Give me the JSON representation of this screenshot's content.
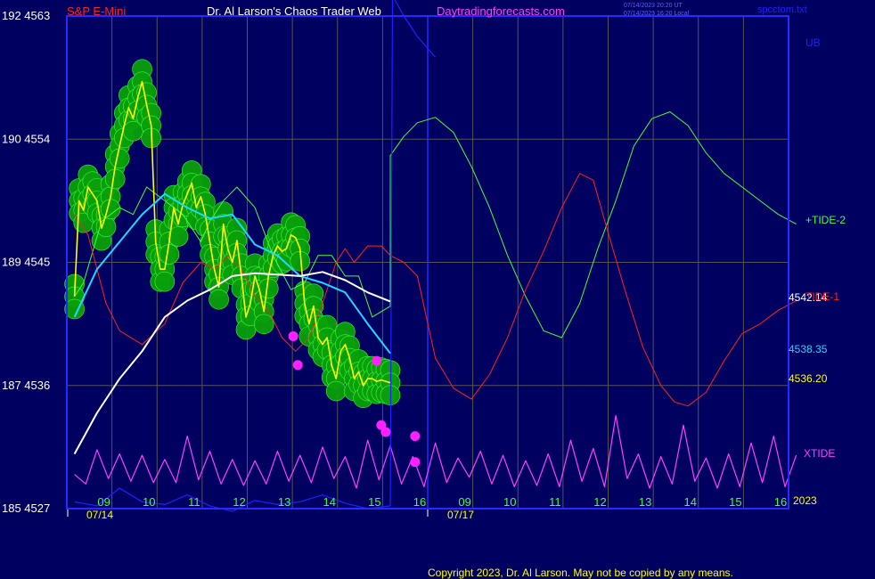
{
  "header": {
    "symbol": "S&P E-Mini",
    "title": "Dr. Al Larson's Chaos Trader Web",
    "site": "Daytradingforecasts.com",
    "stamp1": "07/14/2023 20:20 UT",
    "stamp2": "07/14/2023 16:20 Local",
    "file": "spcctom.txt"
  },
  "copyright": "Copyright 2023, Dr. Al Larson. May not be copied by any means.",
  "colors": {
    "background": "#000060",
    "frame": "#2828ff",
    "grid": "#555555",
    "price": "#ffff00",
    "avg_short": "#20d8ff",
    "avg_long": "#ffffff",
    "tide1": "#ff2020",
    "tide2": "#40ff40",
    "xtide": "#ff40ff",
    "ub": "#2020ff",
    "hour_labels": "#40ff40",
    "bubble": "#0aa00a",
    "bubble_edge": "#40ff40",
    "marker": "#ff20ff"
  },
  "chart_data": {
    "type": "line",
    "title": "S&P E-Mini",
    "y_axis_labels": [
      "192 4563",
      "190 4554",
      "189 4545",
      "187 4536",
      "185 4527"
    ],
    "ylim": [
      4527,
      4563
    ],
    "grid": true,
    "x_tick_labels": [
      "09",
      "10",
      "11",
      "12",
      "13",
      "14",
      "15",
      "16",
      "09",
      "10",
      "11",
      "12",
      "13",
      "14",
      "15",
      "16"
    ],
    "date_labels": [
      "07/14",
      "07/17"
    ],
    "year_label": "2023",
    "price_labels": [
      "4542.14",
      "4538.35",
      "4536.20"
    ],
    "series": [
      {
        "name": "+TIDE-2",
        "x": [
          0,
          0.2,
          0.6,
          1,
          1.3,
          1.6,
          2,
          2.4,
          2.8,
          3.0,
          3.3,
          3.6,
          4.0,
          4.4,
          4.8,
          5.1,
          5.4,
          5.7,
          6.0,
          6.3,
          6.6,
          7.0,
          7.0,
          7.3,
          7.6,
          8.0,
          8.4,
          8.8,
          9.2,
          9.6,
          10.0,
          10.4,
          10.8,
          11.2,
          11.6,
          12.0,
          12.4,
          12.8,
          13.2,
          13.6,
          14.0,
          14.4,
          14.8,
          15.2,
          15.6,
          16.0
        ],
        "y": [
          4542.5,
          4543.5,
          4548,
          4549,
          4548.5,
          4550.5,
          4549.5,
          4548.5,
          4546.5,
          4548,
          4549.5,
          4550.5,
          4549,
          4545.5,
          4543,
          4543.5,
          4545.5,
          4545.5,
          4544,
          4544,
          4541,
          4541.8,
          4552.8,
          4554.2,
          4555.2,
          4555.6,
          4554.5,
          4552,
          4549,
          4545.5,
          4542.5,
          4540,
          4539.5,
          4542,
          4546,
          4549.5,
          4553.5,
          4555.5,
          4556,
          4555,
          4553,
          4551.5,
          4550.5,
          4549.5,
          4548.5,
          4547.8
        ]
      },
      {
        "name": "TIDE-1",
        "x": [
          0,
          0.3,
          0.7,
          1,
          1.5,
          2,
          2.4,
          2.8,
          3.1,
          3.4,
          3.7,
          4.0,
          4.3,
          4.6,
          4.9,
          5.2,
          5.5,
          5.8,
          6.0,
          6.2,
          6.5,
          6.8,
          7.0,
          7.3,
          7.6,
          8.0,
          8.4,
          8.8,
          9.2,
          9.6,
          10.0,
          10.4,
          10.8,
          11.2,
          11.5,
          11.8,
          12.2,
          12.6,
          13.0,
          13.3,
          13.6,
          14.0,
          14.4,
          14.8,
          15.2,
          15.6,
          16.0
        ],
        "y": [
          4548.5,
          4547,
          4542,
          4540,
          4539,
          4540.5,
          4543.5,
          4545,
          4544.5,
          4545.5,
          4544.5,
          4542.5,
          4541.5,
          4539.5,
          4538.5,
          4539.5,
          4542,
          4545,
          4546,
          4545,
          4546.2,
          4546.2,
          4545.5,
          4545,
          4544,
          4538,
          4535.8,
          4535,
          4536.8,
          4539.5,
          4543,
          4545.8,
          4549,
          4551.5,
          4551,
          4547.5,
          4543,
          4538.8,
          4536,
          4534.8,
          4534.5,
          4535.5,
          4537.8,
          4539.8,
          4540.5,
          4541.5,
          4542.2
        ]
      },
      {
        "name": "XTIDE",
        "x": [
          0,
          0.25,
          0.5,
          0.75,
          1.0,
          1.25,
          1.5,
          1.75,
          2.0,
          2.25,
          2.5,
          2.75,
          3.0,
          3.25,
          3.5,
          3.75,
          4.0,
          4.25,
          4.5,
          4.75,
          5.0,
          5.25,
          5.5,
          5.75,
          6.0,
          6.25,
          6.5,
          6.75,
          7.0,
          7.25,
          7.5,
          7.75,
          8.0,
          8.25,
          8.5,
          8.75,
          9.0,
          9.25,
          9.5,
          9.75,
          10.0,
          10.25,
          10.5,
          10.75,
          11.0,
          11.25,
          11.5,
          11.75,
          12.0,
          12.25,
          12.5,
          12.75,
          13.0,
          13.25,
          13.5,
          13.75,
          14.0,
          14.25,
          14.5,
          14.75,
          15.0,
          15.25,
          15.5,
          15.75,
          16.0
        ],
        "y": [
          4529.5,
          4528.8,
          4531.3,
          4529.2,
          4531.0,
          4529.0,
          4530.9,
          4528.9,
          4530.6,
          4528.9,
          4532.3,
          4529.1,
          4531.2,
          4528.8,
          4530.6,
          4528.7,
          4530.5,
          4528.8,
          4531.2,
          4529.0,
          4530.9,
          4528.9,
          4531.5,
          4529.2,
          4530.8,
          4528.5,
          4532.0,
          4529.1,
          4531.6,
          4528.8,
          4530.8,
          4528.6,
          4531.8,
          4528.9,
          4530.7,
          4529.3,
          4531.2,
          4528.8,
          4530.9,
          4528.6,
          4530.5,
          4528.7,
          4531.0,
          4528.6,
          4532.0,
          4529.0,
          4531.4,
          4528.6,
          4533.8,
          4529.2,
          4531.0,
          4528.5,
          4530.8,
          4528.8,
          4533.1,
          4529.0,
          4530.7,
          4528.5,
          4531.0,
          4528.6,
          4531.8,
          4528.9,
          4532.3,
          4528.6,
          4530.9
        ]
      },
      {
        "name": "UB",
        "x": [
          0,
          0.5,
          1.0,
          1.5,
          2.0,
          2.5,
          3.0,
          3.5,
          4.0,
          4.5,
          5.0,
          5.5,
          6.0,
          6.5,
          7.0,
          7.05,
          7.3,
          7.6,
          8.0
        ],
        "y": [
          4527.5,
          4527.2,
          4528.5,
          4527.5,
          4527.3,
          4528.0,
          4527.2,
          4526.8,
          4527.6,
          4527.3,
          4527.5,
          4528.0,
          4527.4,
          4527.0,
          4527.2,
          4564.5,
          4563.0,
          4561.5,
          4560.0
        ]
      },
      {
        "name": "Price",
        "x": [
          0,
          0.1,
          0.2,
          0.3,
          0.4,
          0.5,
          0.6,
          0.7,
          0.8,
          0.9,
          1.0,
          1.1,
          1.2,
          1.3,
          1.4,
          1.5,
          1.6,
          1.7,
          1.8,
          1.9,
          2.0,
          2.1,
          2.2,
          2.3,
          2.4,
          2.5,
          2.6,
          2.7,
          2.8,
          2.9,
          3.0,
          3.1,
          3.2,
          3.3,
          3.4,
          3.5,
          3.6,
          3.7,
          3.8,
          3.9,
          4.0,
          4.1,
          4.2,
          4.3,
          4.4,
          4.5,
          4.6,
          4.7,
          4.8,
          4.9,
          5.0,
          5.1,
          5.2,
          5.3,
          5.4,
          5.5,
          5.6,
          5.7,
          5.8,
          5.9,
          6.0,
          6.1,
          6.2,
          6.3,
          6.4,
          6.5,
          6.6,
          6.7,
          6.8,
          6.9,
          7.0
        ],
        "y": [
          4542.5,
          4549.5,
          4548.8,
          4550.5,
          4550.0,
          4549.5,
          4547.5,
          4548.5,
          4549.8,
          4552.0,
          4553.5,
          4555.0,
          4556.3,
          4555.5,
          4557.0,
          4558.2,
          4556.5,
          4555.0,
          4546.5,
          4544.5,
          4544.5,
          4546.5,
          4549.0,
          4547.8,
          4549.2,
          4550.0,
          4550.8,
          4549.0,
          4549.8,
          4548.5,
          4546.5,
          4544.5,
          4543.2,
          4547.8,
          4546.0,
          4545.0,
          4546.6,
          4544.0,
          4541.0,
          4542.0,
          4544.0,
          4543.0,
          4541.4,
          4544.0,
          4545.5,
          4546.2,
          4545.8,
          4546.0,
          4547.0,
          4546.8,
          4546.0,
          4542.0,
          4540.5,
          4541.8,
          4539.5,
          4539.0,
          4539.5,
          4537.5,
          4536.5,
          4538.5,
          4539.0,
          4538.0,
          4536.5,
          4537.0,
          4536.0,
          4536.5,
          4536.5,
          4536.3,
          4536.4,
          4536.3,
          4536.2
        ]
      },
      {
        "name": "Short average",
        "x": [
          0,
          0.5,
          1.0,
          1.5,
          2.0,
          2.5,
          3.0,
          3.5,
          4.0,
          4.5,
          5.0,
          5.5,
          6.0,
          6.5,
          7.0
        ],
        "y": [
          4541.0,
          4544.5,
          4546.5,
          4548.5,
          4550.0,
          4549.0,
          4548.2,
          4548.5,
          4546.3,
          4545.5,
          4544.0,
          4543.5,
          4542.8,
          4540.5,
          4538.35
        ]
      },
      {
        "name": "Long average",
        "x": [
          0,
          0.5,
          1.0,
          1.5,
          2.0,
          2.5,
          3.0,
          3.5,
          4.0,
          4.5,
          5.0,
          5.5,
          6.0,
          6.5,
          7.0
        ],
        "y": [
          4531.0,
          4534.0,
          4536.5,
          4538.5,
          4541.0,
          4542.2,
          4543.0,
          4544.0,
          4544.2,
          4544.1,
          4544.0,
          4544.3,
          4543.7,
          4542.8,
          4542.14
        ]
      }
    ],
    "markers": [
      {
        "x": 4.85,
        "y": 4539.6
      },
      {
        "x": 4.95,
        "y": 4537.5
      },
      {
        "x": 6.7,
        "y": 4537.8
      },
      {
        "x": 6.8,
        "y": 4533.1
      },
      {
        "x": 6.9,
        "y": 4532.6
      },
      {
        "x": 7.55,
        "y": 4532.3
      },
      {
        "x": 7.55,
        "y": 4530.4
      }
    ]
  }
}
